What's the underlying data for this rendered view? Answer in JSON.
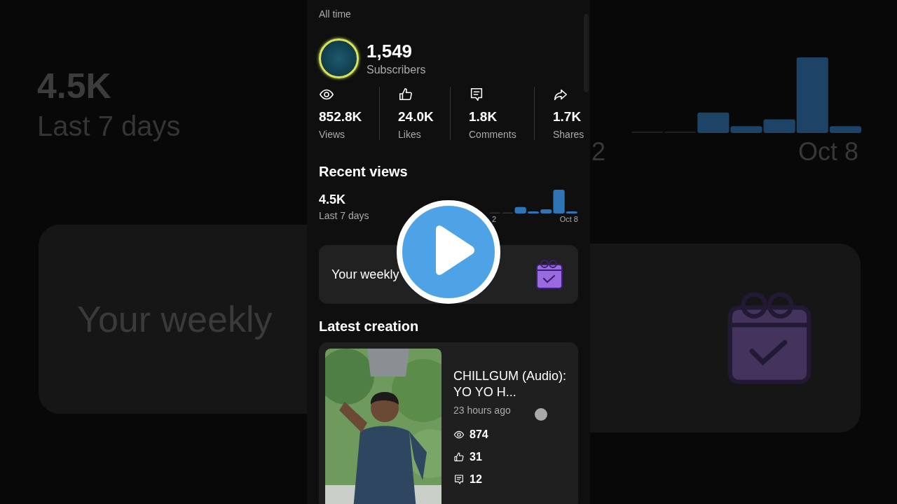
{
  "backdrop": {
    "left": {
      "value": "4.5K",
      "period": "Last 7 days",
      "card_text": "Your weekly"
    },
    "right": {
      "axis_labels": [
        "2",
        "Oct 8"
      ]
    }
  },
  "header": {
    "range": "All time"
  },
  "channel": {
    "subscribers": "1,549",
    "subscribers_label": "Subscribers"
  },
  "stats": [
    {
      "kind": "views",
      "value": "852.8K",
      "label": "Views"
    },
    {
      "kind": "likes",
      "value": "24.0K",
      "label": "Likes"
    },
    {
      "kind": "comments",
      "value": "1.8K",
      "label": "Comments"
    },
    {
      "kind": "shares",
      "value": "1.7K",
      "label": "Shares"
    }
  ],
  "recent_views": {
    "title": "Recent views",
    "value": "4.5K",
    "period": "Last 7 days",
    "axis_labels": [
      "2",
      "Oct 8"
    ]
  },
  "weekly_card": {
    "text": "Your weekly"
  },
  "latest": {
    "title": "Latest creation",
    "video": {
      "kind": "picture",
      "title": "CHILLGUM (Audio): YO YO H...",
      "age": "23 hours ago",
      "stats": [
        {
          "kind": "views",
          "value": "874"
        },
        {
          "kind": "likes",
          "value": "31"
        },
        {
          "kind": "comments",
          "value": "12"
        }
      ]
    }
  }
}
